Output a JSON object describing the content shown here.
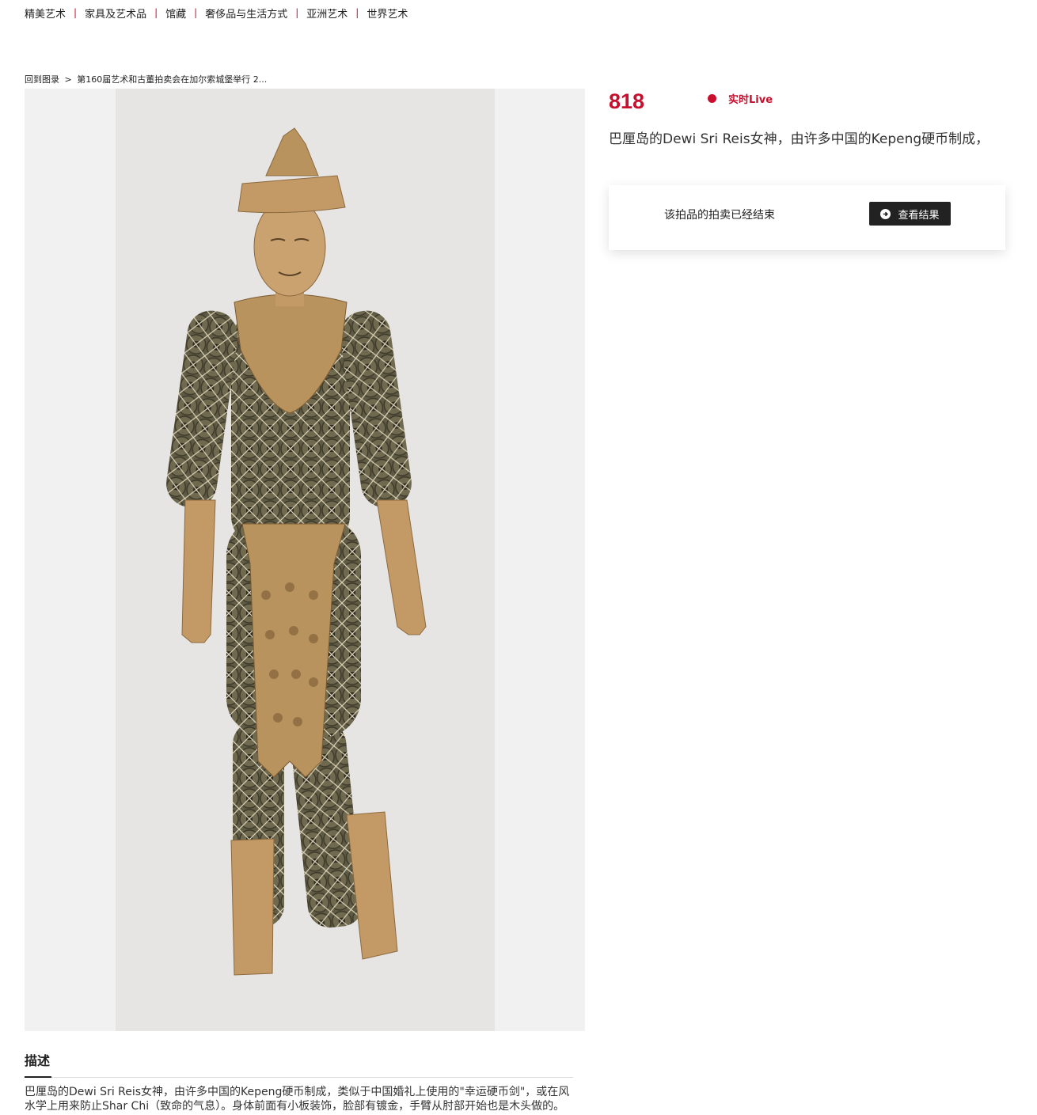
{
  "nav": {
    "items": [
      {
        "label": "精美艺术"
      },
      {
        "label": "家具及艺术品"
      },
      {
        "label": "馆藏"
      },
      {
        "label": "奢侈品与生活方式"
      },
      {
        "label": "亚洲艺术"
      },
      {
        "label": "世界艺术"
      }
    ],
    "separator": "|"
  },
  "breadcrumb": {
    "back_label": "回到图录",
    "separator": ">",
    "current": "第160届艺术和古董拍卖会在加尔索城堡举行 2..."
  },
  "lot": {
    "number": "818",
    "live_label": "实时Live",
    "title": "巴厘岛的Dewi Sri Reis女神，由许多中国的Kepeng硬币制成，"
  },
  "status_card": {
    "message": "该拍品的拍卖已经结束",
    "button_label": "查看结果"
  },
  "description": {
    "heading": "描述",
    "text": "巴厘岛的Dewi Sri Reis女神，由许多中国的Kepeng硬币制成，类似于中国婚礼上使用的\"幸运硬币剑\"，或在风水学上用来防止Shar Chi（致命的气息）。身体前面有小板装饰，脸部有镀金，手臂从肘部开始也是木头做的。"
  },
  "colors": {
    "accent": "#c8102e",
    "button_bg": "#222222",
    "image_bg": "#e6e5e3"
  },
  "icons": {
    "live": "live-dot-icon",
    "results": "arrow-circle-right-icon"
  }
}
